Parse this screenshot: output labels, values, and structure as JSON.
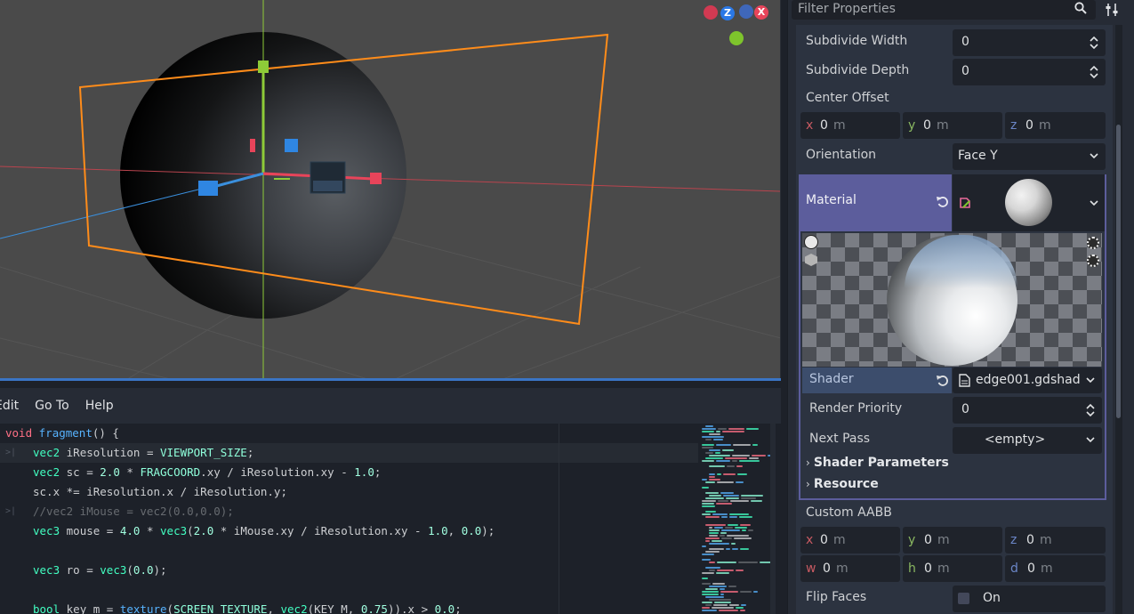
{
  "viewport": {
    "gizmo": {
      "z_label": "Z",
      "x_label": "X"
    }
  },
  "editor": {
    "menu": [
      "Edit",
      "Go To",
      "Help"
    ],
    "code_lines": [
      "void fragment() {",
      "vec2 iResolution = VIEWPORT_SIZE;",
      "vec2 sc = 2.0 * FRAGCOORD.xy / iResolution.xy - 1.0;",
      "sc.x *= iResolution.x / iResolution.y;",
      "//vec2 iMouse = vec2(0.0,0.0);",
      "vec3 mouse = 4.0 * vec3(2.0 * iMouse.xy / iResolution.xy - 1.0, 0.0);",
      "",
      "vec3 ro = vec3(0.0);",
      "",
      "bool key_m = texture(SCREEN_TEXTURE, vec2(KEY_M, 0.75)).x > 0.0;"
    ]
  },
  "inspector": {
    "filter_placeholder": "Filter Properties",
    "subdivide_width": {
      "label": "Subdivide Width",
      "value": "0"
    },
    "subdivide_depth": {
      "label": "Subdivide Depth",
      "value": "0"
    },
    "center_offset": {
      "label": "Center Offset",
      "x": "0",
      "y": "0",
      "z": "0",
      "unit": "m"
    },
    "orientation": {
      "label": "Orientation",
      "value": "Face Y"
    },
    "material": {
      "label": "Material"
    },
    "shader": {
      "label": "Shader",
      "value": "edge001.gdshad"
    },
    "render_priority": {
      "label": "Render Priority",
      "value": "0"
    },
    "next_pass": {
      "label": "Next Pass",
      "value": "<empty>"
    },
    "shader_parameters": "Shader Parameters",
    "resource": "Resource",
    "custom_aabb": {
      "label": "Custom AABB",
      "x": "0",
      "y": "0",
      "z": "0",
      "w": "0",
      "h": "0",
      "d": "0",
      "unit": "m"
    },
    "flip_faces": {
      "label": "Flip Faces",
      "value": "On",
      "checked": false
    }
  },
  "colors": {
    "accent": "#5c5d9c",
    "selection_orange": "#ff8c1a",
    "axis_green": "#8ecb38",
    "axis_red": "#e8445a",
    "axis_blue": "#3a8fdd"
  }
}
